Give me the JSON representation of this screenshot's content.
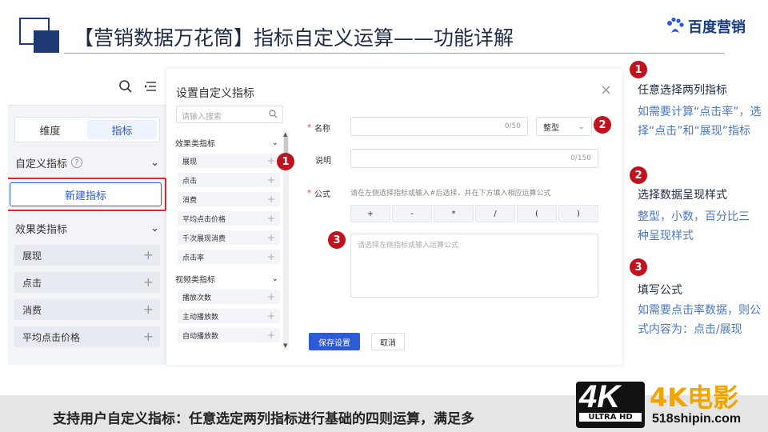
{
  "slide": {
    "title": "【营销数据万花筒】指标自定义运算——功能详解",
    "brand": "百度营销",
    "footer": "支持用户自定义指标：任意选定两列指标进行基础的四则运算，满足多"
  },
  "left_panel": {
    "tabs": [
      "维度",
      "指标"
    ],
    "active_tab": "指标",
    "custom_section": "自定义指标",
    "help_glyph": "?",
    "new_button": "新建指标",
    "effect_section": "效果类指标",
    "items": [
      "展现",
      "点击",
      "消费",
      "平均点击价格"
    ]
  },
  "dialog": {
    "title": "设置自定义指标",
    "close": "×",
    "search_placeholder": "请输入搜索",
    "groups": [
      {
        "name": "效果类指标",
        "items": [
          "展现",
          "点击",
          "消费",
          "平均点击价格",
          "千次展现消费",
          "点击率"
        ]
      },
      {
        "name": "视频类指标",
        "items": [
          "播放次数",
          "主动播放数",
          "自动播放数"
        ]
      }
    ],
    "name_label": "名称",
    "name_counter": "0/50",
    "type_value": "整型",
    "desc_label": "说明",
    "desc_counter": "0/150",
    "formula_label": "公式",
    "formula_hint": "请在左侧选择指标或输入#后选择，并在下方填入相应运算公式",
    "operators": [
      "+",
      "-",
      "*",
      "/",
      "(",
      ")"
    ],
    "formula_placeholder": "请选择左侧指标或输入运算公式",
    "save": "保存设置",
    "cancel": "取消"
  },
  "markers": [
    "1",
    "2",
    "3"
  ],
  "annotations": [
    {
      "num": "1",
      "head": "任意选择两列指标",
      "body": "如需要计算“点击率”，选择“点击”和“展现”指标"
    },
    {
      "num": "2",
      "head": "选择数据呈现样式",
      "body": "整型，小数，百分比三种呈现样式"
    },
    {
      "num": "3",
      "head": "填写公式",
      "body": "如需要点击率数据，则公式内容为：点击/展现"
    }
  ],
  "watermark": {
    "big": "4K",
    "sub": "ULTRA HD",
    "cn": "4K电影",
    "url": "518shipin.com"
  },
  "colors": {
    "accent": "#2d5bd7",
    "marker": "#c1121f",
    "annotation": "#4a78c2",
    "title_navy": "#1d3a73"
  }
}
